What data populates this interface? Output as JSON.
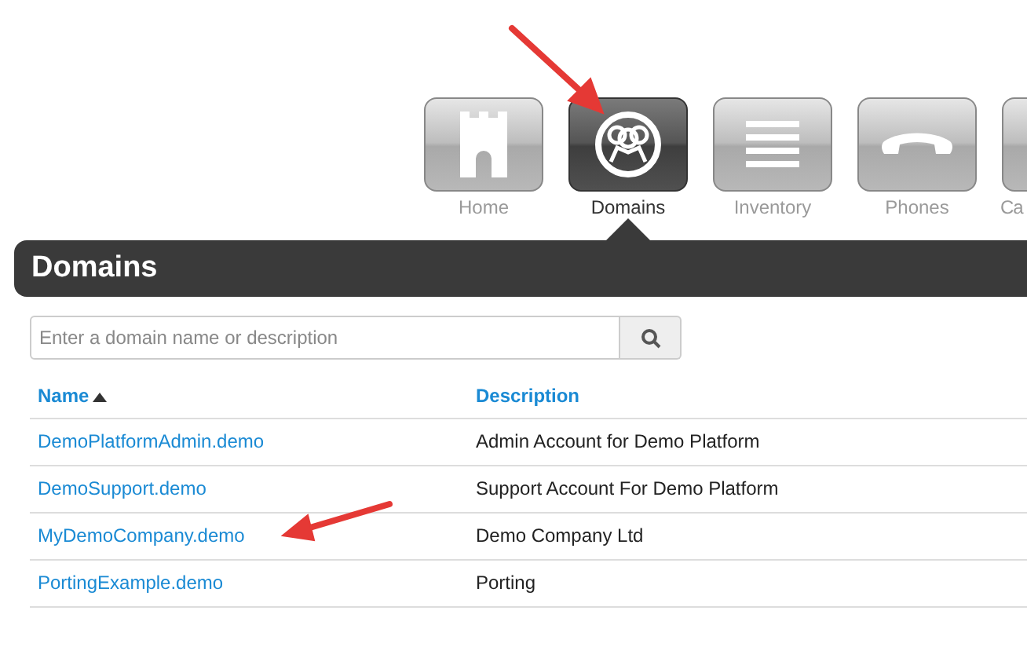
{
  "nav": [
    {
      "label": "Home",
      "kind": "castle",
      "selected": false
    },
    {
      "label": "Domains",
      "kind": "people",
      "selected": true
    },
    {
      "label": "Inventory",
      "kind": "list",
      "selected": false
    },
    {
      "label": "Phones",
      "kind": "phone",
      "selected": false
    },
    {
      "label": "Ca",
      "kind": "blank",
      "selected": false
    }
  ],
  "panel": {
    "title": "Domains"
  },
  "search": {
    "placeholder": "Enter a domain name or description"
  },
  "table": {
    "columns": [
      {
        "label": "Name",
        "sorted": true
      },
      {
        "label": "Description",
        "sorted": false
      }
    ],
    "rows": [
      {
        "name": "DemoPlatformAdmin.demo",
        "description": "Admin Account for Demo Platform"
      },
      {
        "name": "DemoSupport.demo",
        "description": "Support Account For Demo Platform"
      },
      {
        "name": "MyDemoCompany.demo",
        "description": "Demo Company Ltd"
      },
      {
        "name": "PortingExample.demo",
        "description": "Porting"
      }
    ]
  }
}
